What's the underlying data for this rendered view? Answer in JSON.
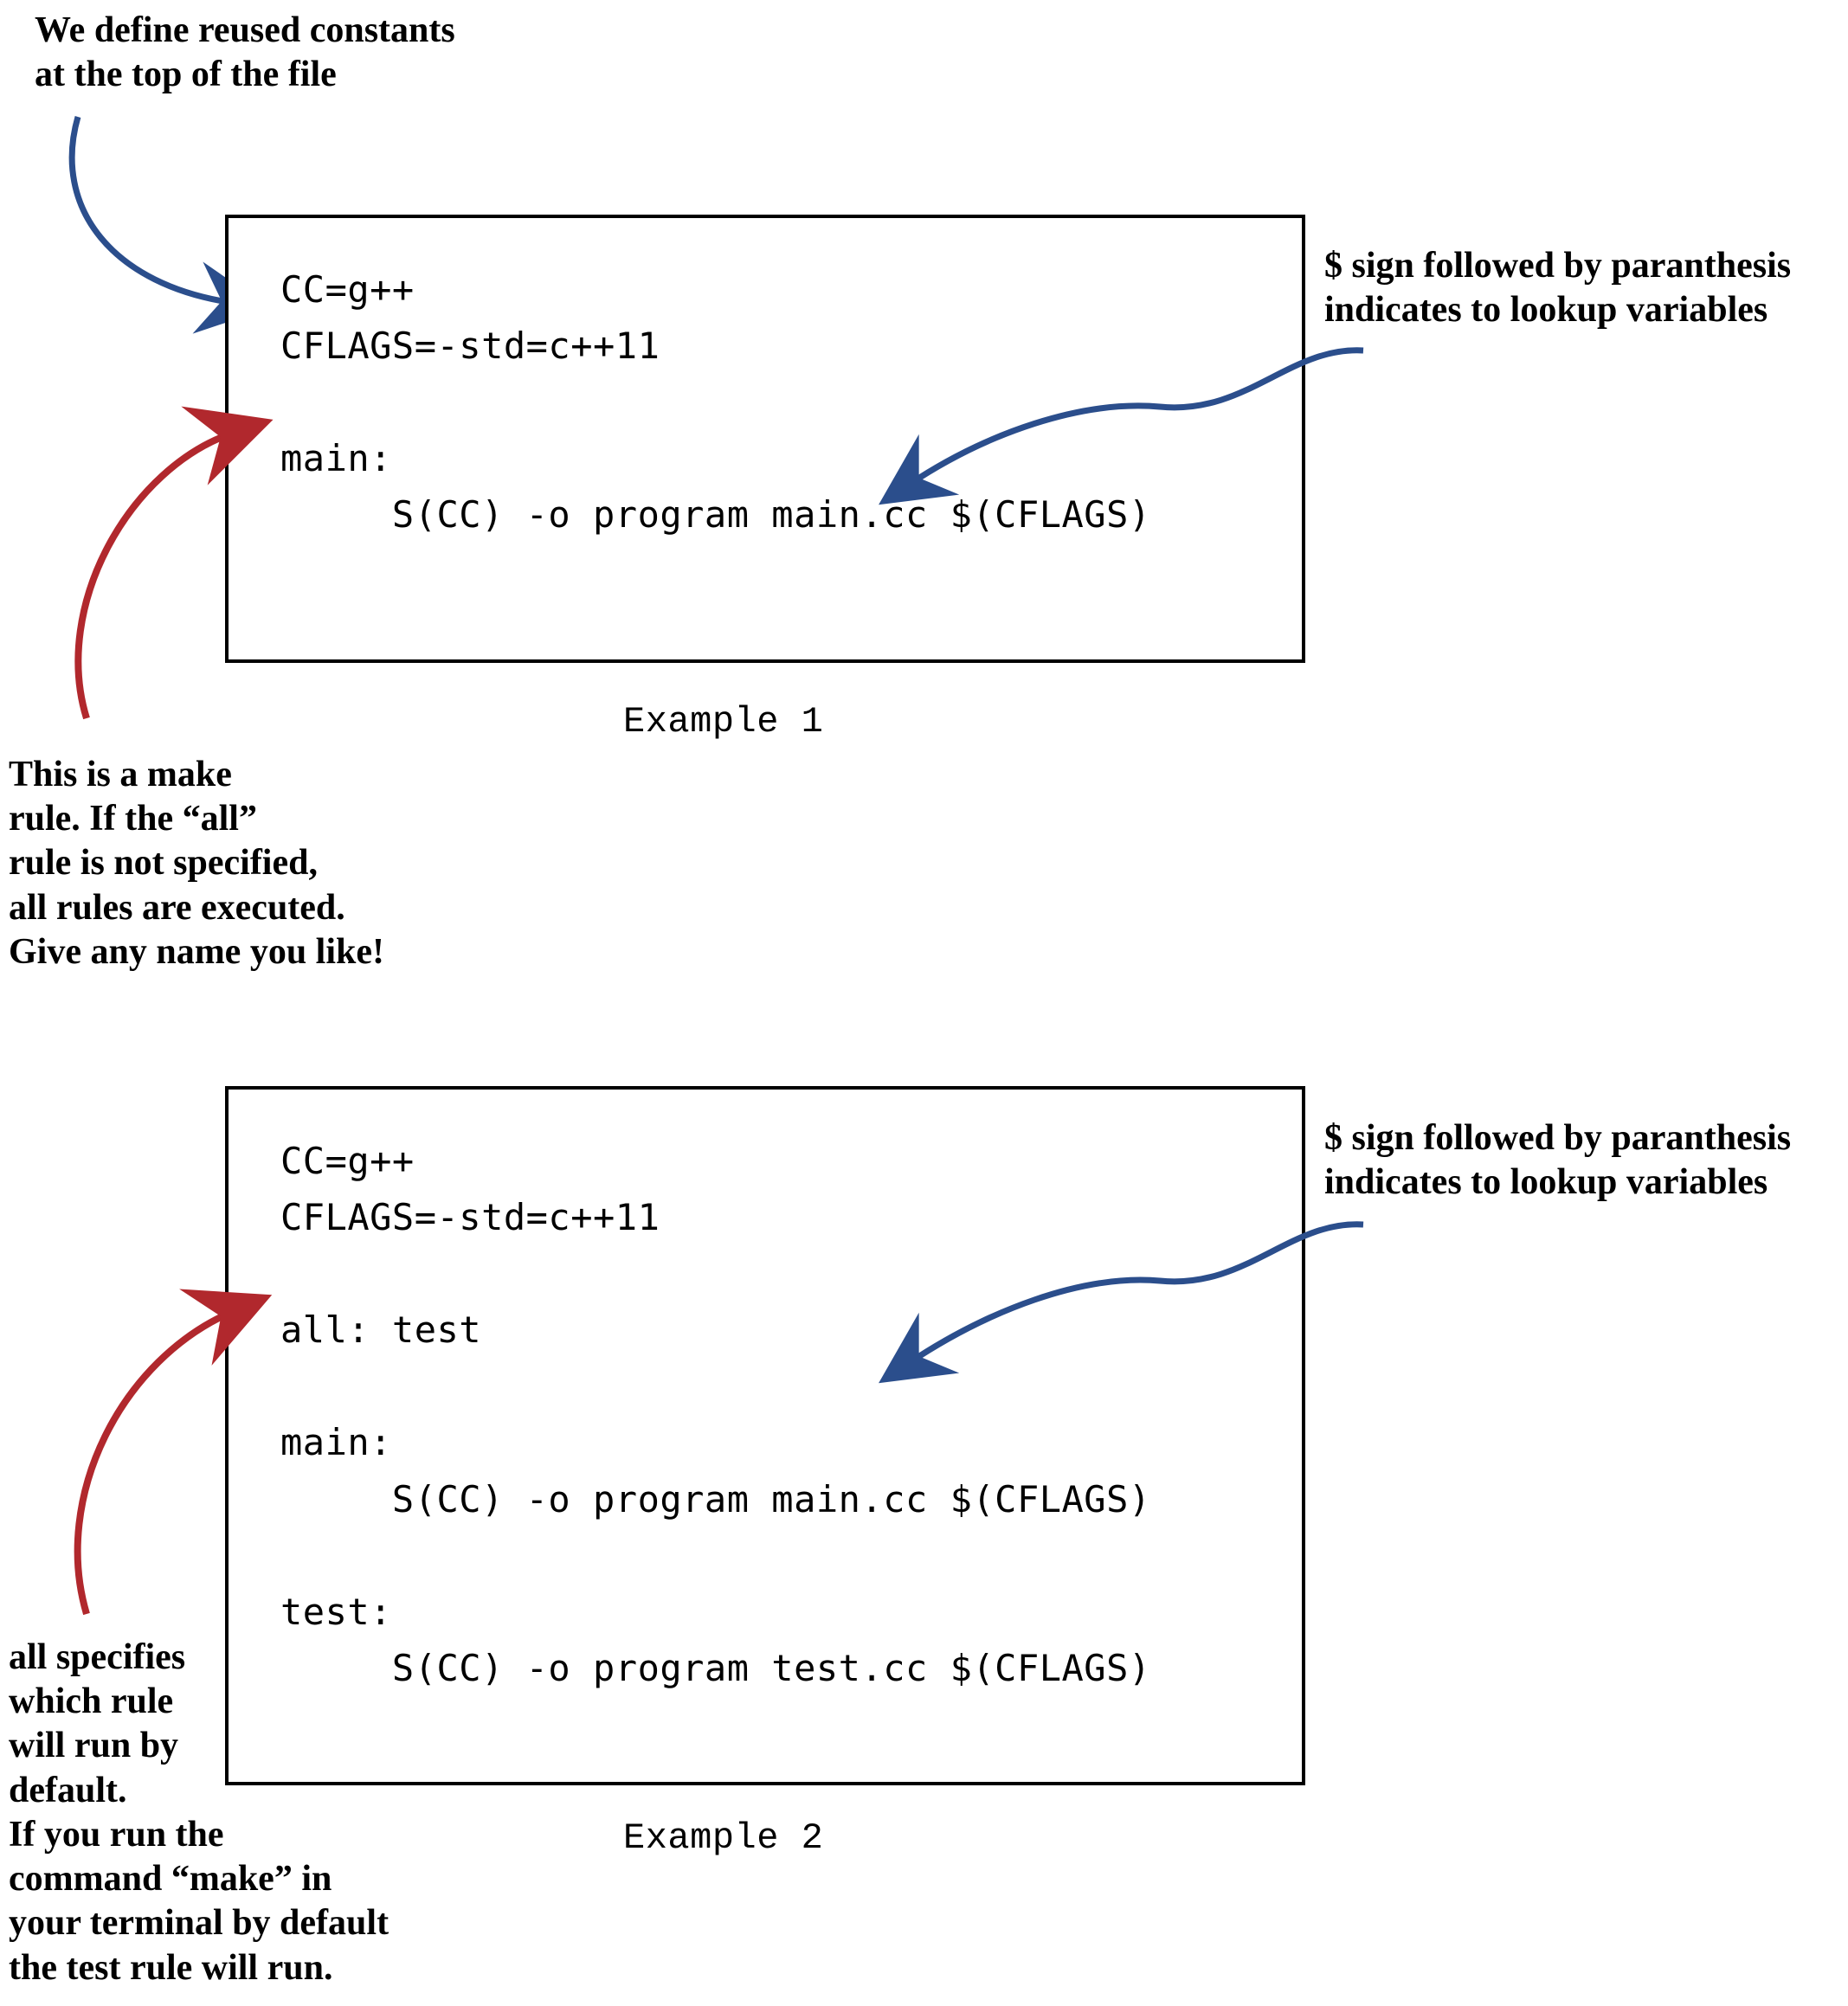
{
  "notes": {
    "define_constants": "We define reused constants\nat the top of the file",
    "lookup_vars": "$ sign followed by paranthesis\nindicates to lookup variables",
    "make_rule": "This is a make\nrule. If the “all”\nrule is not specified,\nall rules are executed.\nGive any name you like!",
    "all_specifies": "all specifies\nwhich rule\nwill run by\ndefault.\nIf you run the\ncommand “make” in\nyour terminal by default\nthe test rule will run."
  },
  "example1": {
    "caption": "Example 1",
    "code": "CC=g++\nCFLAGS=-std=c++11\n\nmain:\n     S(CC) -o program main.cc $(CFLAGS)"
  },
  "example2": {
    "caption": "Example 2",
    "code": "CC=g++\nCFLAGS=-std=c++11\n\nall: test\n\nmain:\n     S(CC) -o program main.cc $(CFLAGS)\n\ntest:\n     S(CC) -o program test.cc $(CFLAGS)"
  },
  "colors": {
    "blue_arrow": "#2b4e8c",
    "red_arrow": "#b1282d"
  }
}
